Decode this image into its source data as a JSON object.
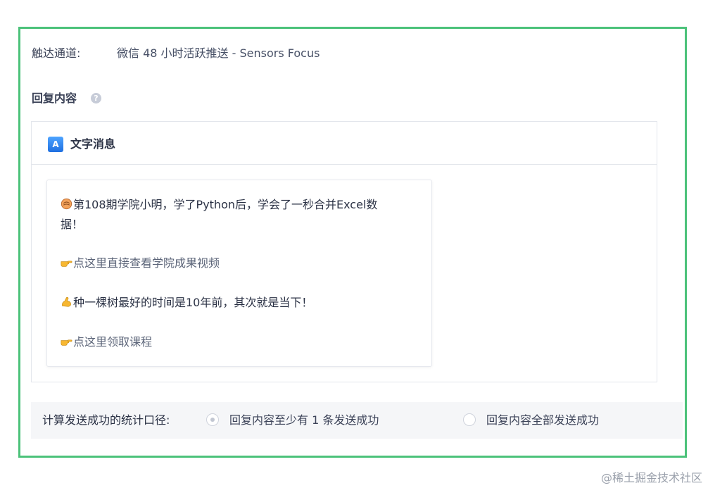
{
  "channel": {
    "label": "触达通道:",
    "value": "微信 48 小时活跃推送 - Sensors Focus"
  },
  "reply": {
    "title": "回复内容",
    "help_icon": "question-circle-icon"
  },
  "card": {
    "icon_letter": "A",
    "title": "文字消息"
  },
  "message": {
    "line1": "第108期学院小明，学了Python后，学会了一秒合并Excel数",
    "line1_cont": "据！",
    "link1": "点这里直接查看学院成果视频",
    "line2": "种一棵树最好的时间是10年前，其次就是当下！",
    "link2": "点这里领取课程",
    "emojis": [
      "fist-emoji",
      "pointing-hand-emoji",
      "flexed-biceps-emoji",
      "pointing-hand-emoji"
    ]
  },
  "footer": {
    "label": "计算发送成功的统计口径:",
    "options": [
      {
        "label": "回复内容至少有 1 条发送成功",
        "checked": true
      },
      {
        "label": "回复内容全部发送成功",
        "checked": false
      }
    ]
  },
  "watermark": "@稀土掘金技术社区",
  "colors": {
    "frame_border": "#4cc27a",
    "accent": "#1f6fe0"
  }
}
